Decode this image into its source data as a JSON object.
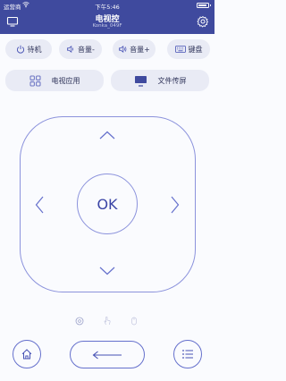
{
  "status_bar": {
    "carrier": "运营商",
    "time": "下午5:46"
  },
  "header": {
    "title": "电视控",
    "subtitle": "Konka_049F"
  },
  "top_row": {
    "standby": "待机",
    "volume_down": "音量-",
    "volume_up": "音量+",
    "keyboard": "键盘"
  },
  "second_row": {
    "tv_apps": "电视应用",
    "file_cast": "文件传屏"
  },
  "dpad": {
    "ok_label": "OK"
  },
  "colors": {
    "header_bg": "#3f4a9e",
    "accent": "#6570cc",
    "button_bg": "#e9ebf5"
  }
}
